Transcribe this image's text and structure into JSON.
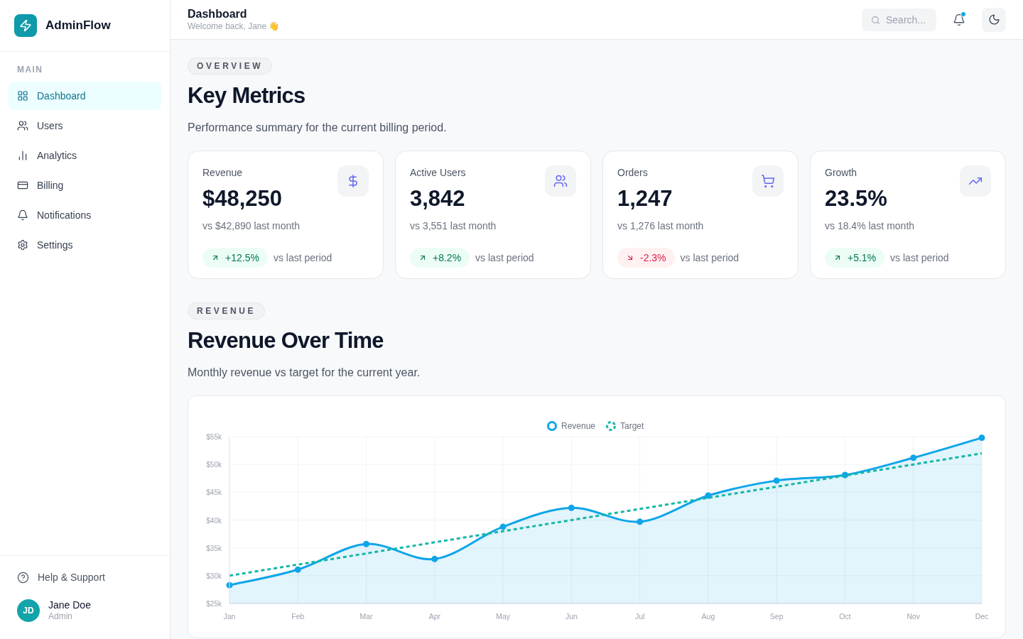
{
  "sidebar": {
    "brand": "AdminFlow",
    "section_label": "MAIN",
    "items": [
      {
        "label": "Dashboard",
        "selected": true
      },
      {
        "label": "Users",
        "selected": false
      },
      {
        "label": "Analytics",
        "selected": false
      },
      {
        "label": "Billing",
        "selected": false
      },
      {
        "label": "Notifications",
        "selected": false
      },
      {
        "label": "Settings",
        "selected": false
      }
    ],
    "help": "Help & Support",
    "user": {
      "initials": "JD",
      "name": "Jane Doe",
      "role": "Admin"
    }
  },
  "header": {
    "title": "Dashboard",
    "subtitle": "Welcome back, Jane 👋",
    "search": {
      "placeholder": "Search..."
    },
    "notification_dot": true
  },
  "overview": {
    "eyebrow": "OVERVIEW",
    "title": "Key Metrics",
    "description": "Performance summary for the current billing period.",
    "metrics": [
      {
        "label": "Revenue",
        "value": "$48,250",
        "comparison": "vs $42,890 last month",
        "change": "+12.5%",
        "kind": "up",
        "change_note": "vs last period"
      },
      {
        "label": "Active Users",
        "value": "3,842",
        "comparison": "vs 3,551 last month",
        "change": "+8.2%",
        "kind": "up",
        "change_note": "vs last period"
      },
      {
        "label": "Orders",
        "value": "1,247",
        "comparison": "vs 1,276 last month",
        "change": "-2.3%",
        "kind": "down",
        "change_note": "vs last period"
      },
      {
        "label": "Growth",
        "value": "23.5%",
        "comparison": "vs 18.4% last month",
        "change": "+5.1%",
        "kind": "up",
        "change_note": "vs last period"
      }
    ]
  },
  "revenue": {
    "eyebrow": "REVENUE",
    "title": "Revenue Over Time",
    "description": "Monthly revenue vs target for the current year.",
    "chart_data": {
      "type": "area",
      "grid": true,
      "legend": "top",
      "categories": [
        "Jan",
        "Feb",
        "Mar",
        "Apr",
        "May",
        "Jun",
        "Jul",
        "Aug",
        "Sep",
        "Oct",
        "Nov",
        "Dec"
      ],
      "ylim": [
        25000,
        55000
      ],
      "yticks": [
        {
          "value": 25000,
          "label": "$25k"
        },
        {
          "value": 30000,
          "label": "$30k"
        },
        {
          "value": 35000,
          "label": "$35k"
        },
        {
          "value": 40000,
          "label": "$40k"
        },
        {
          "value": 45000,
          "label": "$45k"
        },
        {
          "value": 50000,
          "label": "$50k"
        },
        {
          "value": 55000,
          "label": "$55k"
        }
      ],
      "series": [
        {
          "name": "Revenue",
          "type": "area",
          "line_style": "solid",
          "color": "#0ea5e9",
          "values": [
            28300,
            31100,
            35700,
            33000,
            38800,
            42200,
            39700,
            44400,
            47100,
            48100,
            51200,
            54800
          ]
        },
        {
          "name": "Target",
          "type": "line",
          "line_style": "dashed",
          "color": "#14b8a6",
          "values": [
            30000,
            32000,
            34000,
            36000,
            38000,
            40000,
            42000,
            44000,
            46000,
            48000,
            50000,
            52000
          ]
        }
      ]
    }
  }
}
